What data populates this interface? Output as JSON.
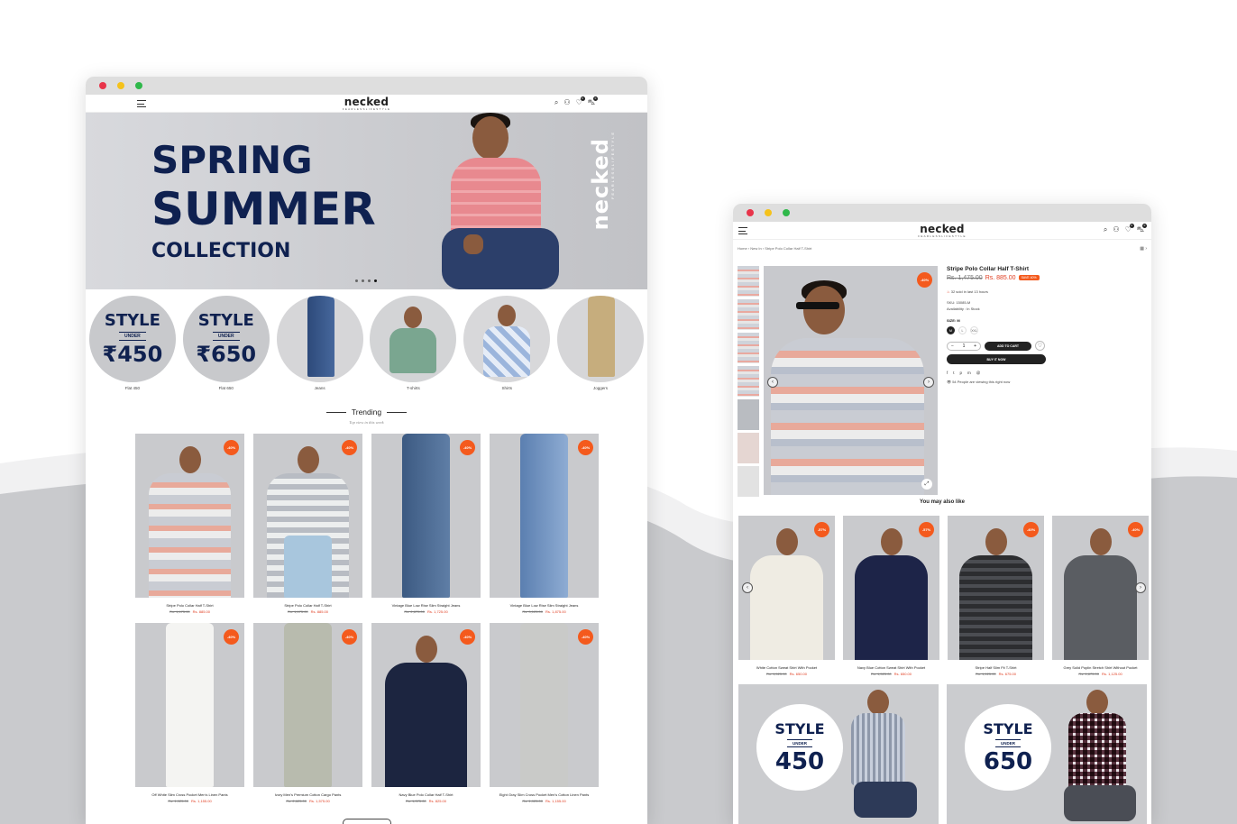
{
  "colors": {
    "accent": "#f45a1d",
    "navy": "#0f2150",
    "price_red": "#e03c1f",
    "dot_red": "#e8344a",
    "dot_yellow": "#f5c21b",
    "dot_green": "#2fb84a"
  },
  "brand": {
    "logo": "necked",
    "tagline": "FEARLESSLIFESTYLE"
  },
  "header_icons": [
    "search-icon",
    "user-icon",
    "heart-icon",
    "cart-icon"
  ],
  "header_badges": {
    "wishlist": "0",
    "cart": "0"
  },
  "hero": {
    "line1": "SPRING",
    "line2": "SUMMER",
    "line3": "COLLECTION",
    "vertical_logo": "necked",
    "vertical_tagline": "FEARLESSLIFESTYLE"
  },
  "categories": [
    {
      "style": "STYLE",
      "under": "UNDER",
      "price": "₹450",
      "label": "Flat 450"
    },
    {
      "style": "STYLE",
      "under": "UNDER",
      "price": "₹650",
      "label": "Flat 650"
    },
    {
      "label": "Jeans"
    },
    {
      "label": "T-shirts"
    },
    {
      "label": "Shirts"
    },
    {
      "label": "Joggers"
    }
  ],
  "trending": {
    "title": "Trending",
    "subtitle": "Top view in this week"
  },
  "products": [
    {
      "name": "Stripe Polo Collar Half T-Shirt",
      "old": "Rs. 1,475.00",
      "new": "Rs. 885.00",
      "badge": "-40%"
    },
    {
      "name": "Stripe Polo Collar Half T-Shirt",
      "old": "Rs. 1,475.00",
      "new": "Rs. 885.00",
      "badge": "-40%"
    },
    {
      "name": "Vintage Blue Low Rise Slim Straight Jeans",
      "old": "Rs. 2,875.00",
      "new": "Rs. 1,725.00",
      "badge": "-40%"
    },
    {
      "name": "Vintage Blue Low Rise Slim Straight Jeans",
      "old": "Rs. 3,125.00",
      "new": "Rs. 1,875.00",
      "badge": "-40%"
    },
    {
      "name": "Off White Slim Cross Pocket Men's Linen Pants",
      "old": "Rs. 1,925.00",
      "new": "Rs. 1,155.00",
      "badge": "-40%"
    },
    {
      "name": "Ivory Men's Premium Cotton Cargo Pants",
      "old": "Rs. 2,625.00",
      "new": "Rs. 1,575.00",
      "badge": "-40%"
    },
    {
      "name": "Navy Blue Polo Collar Half T-Shirt",
      "old": "Rs. 1,375.00",
      "new": "Rs. 825.00",
      "badge": "-40%"
    },
    {
      "name": "Eight Gray Slim Cross Pocket Men's Cotton Linen Pants",
      "old": "Rs. 1,925.00",
      "new": "Rs. 1,155.00",
      "badge": "-40%"
    }
  ],
  "pdp": {
    "breadcrumb": "Home › New In › Stripe Polo Collar Half T-Shirt",
    "title": "Stripe Polo Collar Half T-Shirt",
    "old": "Rs. 1,475.00",
    "new": "Rs. 885.00",
    "save": "SAVE 40%",
    "sold": "32 sold in last 13 hours",
    "sku": "SKU: 15085-M",
    "availability": "Availability : In Stock",
    "size_label": "SIZE: M",
    "sizes": [
      "M",
      "L",
      "XXL"
    ],
    "qty": "1",
    "add_to_cart": "ADD TO CART",
    "buy_now": "BUY IT NOW",
    "viewing": "54 People are viewing this right now",
    "badge": "-40%",
    "social": [
      "f",
      "t",
      "p",
      "m",
      "@"
    ]
  },
  "ymal": {
    "title": "You may also like",
    "items": [
      {
        "name": "White Cotton Sweat Shirt With Pocket",
        "old": "Rs. 1,525.00",
        "new": "Rs. 650.00",
        "badge": "-57%"
      },
      {
        "name": "Navy Blue Cotton Sweat Shirt With Pocket",
        "old": "Rs. 1,525.00",
        "new": "Rs. 650.00",
        "badge": "-57%"
      },
      {
        "name": "Stripe Half Slim Fit T-Shirt",
        "old": "Rs. 1,125.00",
        "new": "Rs. 675.00",
        "badge": "-40%"
      },
      {
        "name": "Grey Solid Poplin Stretch Shirt Without Pocket",
        "old": "Rs. 1,875.00",
        "new": "Rs. 1,125.00",
        "badge": "-40%"
      }
    ]
  },
  "banners": [
    {
      "style": "STYLE",
      "under": "UNDER",
      "price": "450"
    },
    {
      "style": "STYLE",
      "under": "UNDER",
      "price": "650"
    }
  ]
}
